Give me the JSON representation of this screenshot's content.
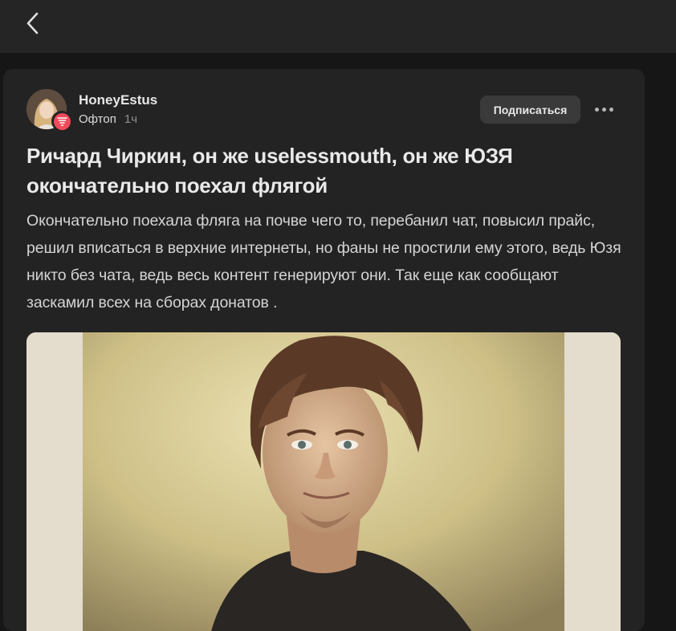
{
  "header": {
    "back_icon": "chevron-left-icon"
  },
  "post": {
    "author": "HoneyEstus",
    "category": "Офтоп",
    "time": "1ч",
    "subscribe_label": "Подписаться",
    "title": "Ричард Чиркин, он же uselessmouth, он же ЮЗЯ окончательно поехал флягой",
    "body": "Окончательно поехала фляга на почве чего то, перебанил чат, повысил прайс, решил вписаться в верхние интернеты, но фаны не простили ему этого, ведь Юзя никто без чата, ведь весь контент генерируют они. Так еще как сообщают заскамил всех на сборах донатов .",
    "more_icon": "more-dots-icon",
    "badge_icon": "tornado-icon"
  },
  "colors": {
    "background": "#161616",
    "topbar": "#252525",
    "card": "#232323",
    "badge": "#f04a5b",
    "button": "#3a3a3a"
  }
}
